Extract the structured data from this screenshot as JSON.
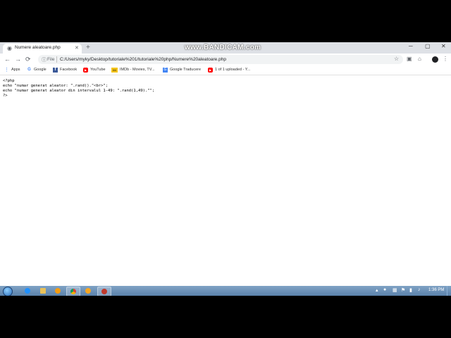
{
  "tab": {
    "title": "Numere aleatoare.php",
    "close": "✕",
    "new_tab": "+"
  },
  "watermark": "www.BANDICAM.com",
  "window_controls": {
    "minimize": "─",
    "maximize": "▢",
    "close": "✕"
  },
  "nav": {
    "back": "←",
    "forward": "→",
    "reload": "⟳"
  },
  "address": {
    "info": "ⓘ",
    "scheme_label": "File",
    "url": "C:/Users/myky/Desktop/tutoriale%201/tutoriale%20php/Numere%20aleatoare.php",
    "star": "☆"
  },
  "toolbar_icons": {
    "ext1": "▣",
    "ext2": "⌂",
    "menu": "⋮"
  },
  "bookmarks": [
    {
      "label": "Apps",
      "icon": "apps-icon"
    },
    {
      "label": "Google",
      "icon": "google-icon"
    },
    {
      "label": "Facebook",
      "icon": "facebook-icon"
    },
    {
      "label": "YouTube",
      "icon": "youtube-icon"
    },
    {
      "label": "IMDb - Movies, TV...",
      "icon": "imdb-icon"
    },
    {
      "label": "Google Traducere",
      "icon": "translate-icon"
    },
    {
      "label": "1 of 1 uploaded - Y...",
      "icon": "youtube-icon"
    }
  ],
  "code_lines": [
    "<?php",
    "echo \"numar generat aleator: \".rand().\"<br>\";",
    "echo \"numar generat aleator din intervalul 1-49: \".rand(1,49).\"\";",
    "?>"
  ],
  "taskbar": {
    "clock": "1:36 PM",
    "apps": [
      "ie-icon",
      "explorer-icon",
      "media-player-icon",
      "chrome-icon",
      "chrome-canary-icon",
      "bandicam-icon"
    ]
  },
  "colors": {
    "tab_strip": "#dee1e6",
    "taskbar": "#6a8fb8",
    "facebook": "#3b5998",
    "youtube": "#ff0000",
    "imdb": "#f5c518"
  }
}
